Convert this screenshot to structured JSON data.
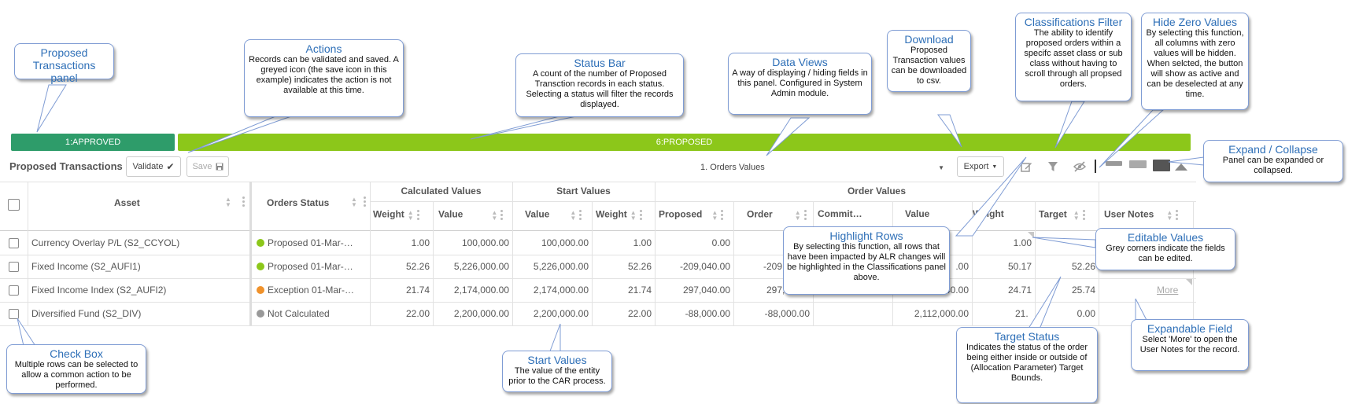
{
  "status_bar": {
    "approved_label": "1:APPROVED",
    "approved_color": "#2e9c6a",
    "proposed_label": "6:PROPOSED",
    "proposed_color": "#8cc71a"
  },
  "toolbar": {
    "title": "Proposed Transactions",
    "validate_label": "Validate",
    "save_label": "Save",
    "views_selected": "1. Orders Values",
    "export_label": "Export"
  },
  "table": {
    "headers": {
      "asset": "Asset",
      "orders_status": "Orders Status",
      "calculated_values": "Calculated Values",
      "start_values": "Start Values",
      "order_values": "Order Values",
      "weight": "Weight",
      "value": "Value",
      "proposed": "Proposed",
      "order": "Order",
      "commit": "Commit…",
      "target": "Target",
      "user_notes": "User Notes"
    },
    "rows": [
      {
        "asset": "Currency Overlay P/L (S2_CCYOL)",
        "status": "Proposed 01-Mar-…",
        "status_color": "#8cc71a",
        "calc_weight": "1.00",
        "calc_value": "100,000.00",
        "start_value": "100,000.00",
        "start_weight": "1.00",
        "proposed": "0.00",
        "order": "",
        "commit": "",
        "ov_value": "",
        "ov_weight": "1.00",
        "target": "",
        "notes": ""
      },
      {
        "asset": "Fixed Income (S2_AUFI1)",
        "status": "Proposed 01-Mar-…",
        "status_color": "#8cc71a",
        "calc_weight": "52.26",
        "calc_value": "5,226,000.00",
        "start_value": "5,226,000.00",
        "start_weight": "52.26",
        "proposed": "-209,040.00",
        "order": "-209,0",
        "commit": "",
        "ov_value": ".00",
        "ov_weight": "50.17",
        "target": "52.26",
        "notes": ""
      },
      {
        "asset": "Fixed Income Index (S2_AUFI2)",
        "status": "Exception 01-Mar-…",
        "status_color": "#f0922b",
        "calc_weight": "21.74",
        "calc_value": "2,174,000.00",
        "start_value": "2,174,000.00",
        "start_weight": "21.74",
        "proposed": "297,040.00",
        "order": "297,0",
        "commit": "",
        "ov_value": "2,471,040.00",
        "ov_weight": "24.71",
        "target": "25.74",
        "notes": ""
      },
      {
        "asset": "Diversified Fund (S2_DIV)",
        "status": "Not Calculated",
        "status_color": "#999999",
        "calc_weight": "22.00",
        "calc_value": "2,200,000.00",
        "start_value": "2,200,000.00",
        "start_weight": "22.00",
        "proposed": "-88,000.00",
        "order": "-88,000.00",
        "commit": "",
        "ov_value": "2,112,000.00",
        "ov_weight": "21.",
        "target": "0.00",
        "notes": "More"
      }
    ]
  },
  "callouts": {
    "proposed_panel": {
      "title": "Proposed Transactions panel",
      "body": ""
    },
    "actions": {
      "title": "Actions",
      "body": "Records can be validated and saved. A greyed icon (the save icon in this example) indicates the action is not available at this time."
    },
    "status_bar": {
      "title": "Status Bar",
      "body": "A count of the number of Proposed Transction records in each status. Selecting a status will filter the records displayed."
    },
    "data_views": {
      "title": "Data Views",
      "body": "A way of displaying / hiding fields in this panel. Configured in System Admin module."
    },
    "download": {
      "title": "Download",
      "body": "Proposed Transaction values can be downloaded to csv."
    },
    "classifications_filter": {
      "title": "Classifications Filter",
      "body": "The ability to identify proposed orders within a specifc asset class or sub class without having to scroll through all propsed orders."
    },
    "hide_zero": {
      "title": "Hide Zero Values",
      "body": "By selecting this function, all columns with zero values will be hidden. When selcted, the button will show as active and can be deselected at any time."
    },
    "expand_collapse": {
      "title": "Expand / Collapse",
      "body": "Panel can be expanded or collapsed."
    },
    "highlight_rows": {
      "title": "Highlight Rows",
      "body": "By selecting this function, all rows that have been impacted by ALR changes will be highlighted in the Classifications panel above."
    },
    "editable_values": {
      "title": "Editable Values",
      "body": "Grey corners indicate the fields can be edited."
    },
    "check_box": {
      "title": "Check Box",
      "body": "Multiple rows can be selected to allow a common action to be performed."
    },
    "start_values": {
      "title": "Start Values",
      "body": "The value of the entity prior to the CAR process."
    },
    "target_status": {
      "title": "Target Status",
      "body": "Indicates the status of the order being either inside or outside of (Allocation Parameter) Target Bounds."
    },
    "expandable_field": {
      "title": "Expandable Field",
      "body": "Select 'More' to open the User Notes for the record."
    }
  }
}
